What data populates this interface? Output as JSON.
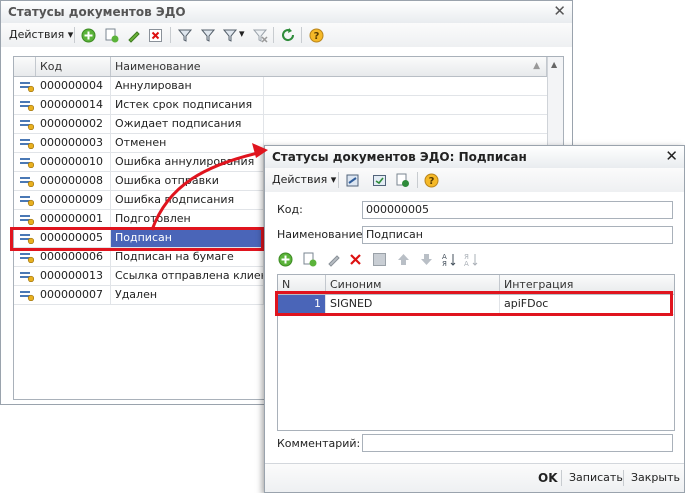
{
  "main_window": {
    "title": "Статусы документов ЭДО",
    "actions_label": "Действия",
    "columns": {
      "code": "Код",
      "name": "Наименование"
    },
    "rows": [
      {
        "code": "000000004",
        "name": "Аннулирован"
      },
      {
        "code": "000000014",
        "name": "Истек срок подписания"
      },
      {
        "code": "000000002",
        "name": "Ожидает подписания"
      },
      {
        "code": "000000003",
        "name": "Отменен"
      },
      {
        "code": "000000010",
        "name": "Ошибка аннулирования"
      },
      {
        "code": "000000008",
        "name": "Ошибка отправки"
      },
      {
        "code": "000000009",
        "name": "Ошибка подписания"
      },
      {
        "code": "000000001",
        "name": "Подготовлен"
      },
      {
        "code": "000000005",
        "name": "Подписан"
      },
      {
        "code": "000000006",
        "name": "Подписан на бумаге"
      },
      {
        "code": "000000013",
        "name": "Ссылка отправлена клиенту"
      },
      {
        "code": "000000007",
        "name": "Удален"
      }
    ],
    "selected_row_index": 8
  },
  "detail_window": {
    "title": "Статусы документов ЭДО: Подписан",
    "actions_label": "Действия",
    "code_label": "Код:",
    "code_value": "000000005",
    "name_label": "Наименование:",
    "name_value": "Подписан",
    "table_columns": {
      "n": "N",
      "synonym": "Синоним",
      "integration": "Интеграция"
    },
    "table_rows": [
      {
        "n": "1",
        "synonym": "SIGNED",
        "integration": "apiFDoc"
      }
    ],
    "comment_label": "Комментарий:",
    "comment_value": "",
    "ok_label": "OK",
    "save_label": "Записать",
    "close_label": "Закрыть"
  },
  "colors": {
    "selection": "#4a65b8",
    "highlight_box": "#e0141e",
    "arrow": "#e0141e"
  }
}
